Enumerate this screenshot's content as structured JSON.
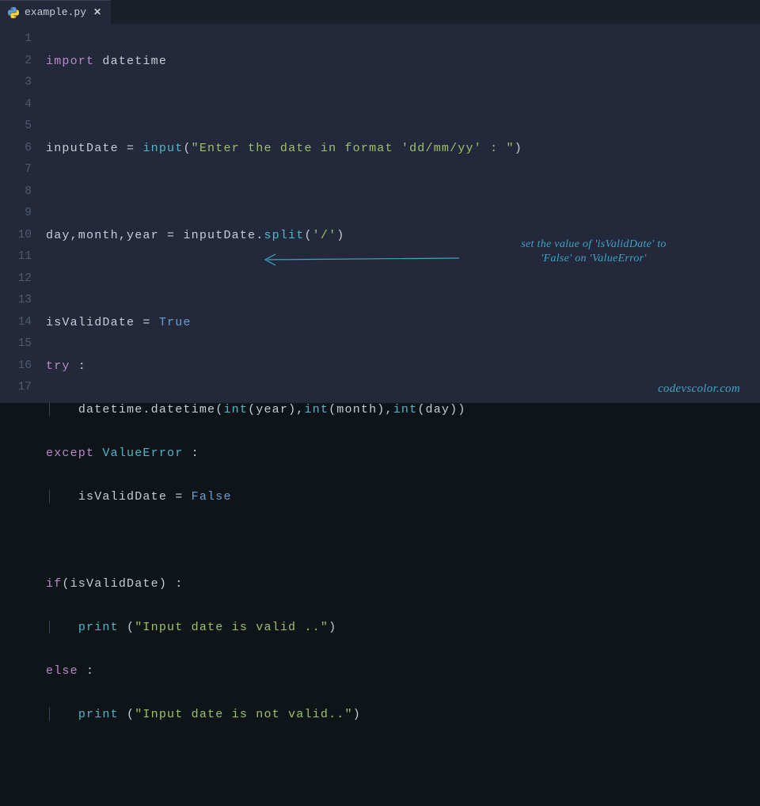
{
  "tab": {
    "filename": "example.py",
    "icon": "python-file-icon"
  },
  "gutter": {
    "start": 1,
    "end": 17
  },
  "code": {
    "l1": {
      "kw": "import",
      "sp": " ",
      "mod": "datetime"
    },
    "l3": {
      "ident": "inputDate",
      "op1": " = ",
      "func": "input",
      "op2": "(",
      "str": "\"Enter the date in format 'dd/mm/yy' : \"",
      "op3": ")"
    },
    "l5": {
      "ident": "day,month,year",
      "op1": " = ",
      "ident2": "inputDate.",
      "func": "split",
      "op2": "(",
      "str": "'/'",
      "op3": ")"
    },
    "l7": {
      "ident": "isValidDate",
      "op1": " = ",
      "const": "True"
    },
    "l8": {
      "kw": "try",
      "op": " :"
    },
    "l9": {
      "indent": "│   ",
      "call": "datetime.datetime",
      "op1": "(",
      "f1": "int",
      "p1": "(year),",
      "f2": "int",
      "p2": "(month),",
      "f3": "int",
      "p3": "(day))"
    },
    "l10": {
      "kw": "except",
      "sp": " ",
      "cls": "ValueError",
      "op": " :"
    },
    "l11": {
      "indent": "│   ",
      "ident": "isValidDate",
      "op1": " = ",
      "const": "False"
    },
    "l13": {
      "kw": "if",
      "op1": "(",
      "ident": "isValidDate",
      "op2": ") :"
    },
    "l14": {
      "indent": "│   ",
      "func": "print",
      "sp": " ",
      "op1": "(",
      "str": "\"Input date is valid ..\"",
      "op2": ")"
    },
    "l15": {
      "kw": "else",
      "op": " :"
    },
    "l16": {
      "indent": "│   ",
      "func": "print",
      "sp": " ",
      "op1": "(",
      "str": "\"Input date is not valid..\"",
      "op2": ")"
    }
  },
  "annotation": {
    "line1": "set the value of 'isValidDate' to",
    "line2": "'False' on 'ValueError'",
    "credit": "codevscolor.com"
  }
}
